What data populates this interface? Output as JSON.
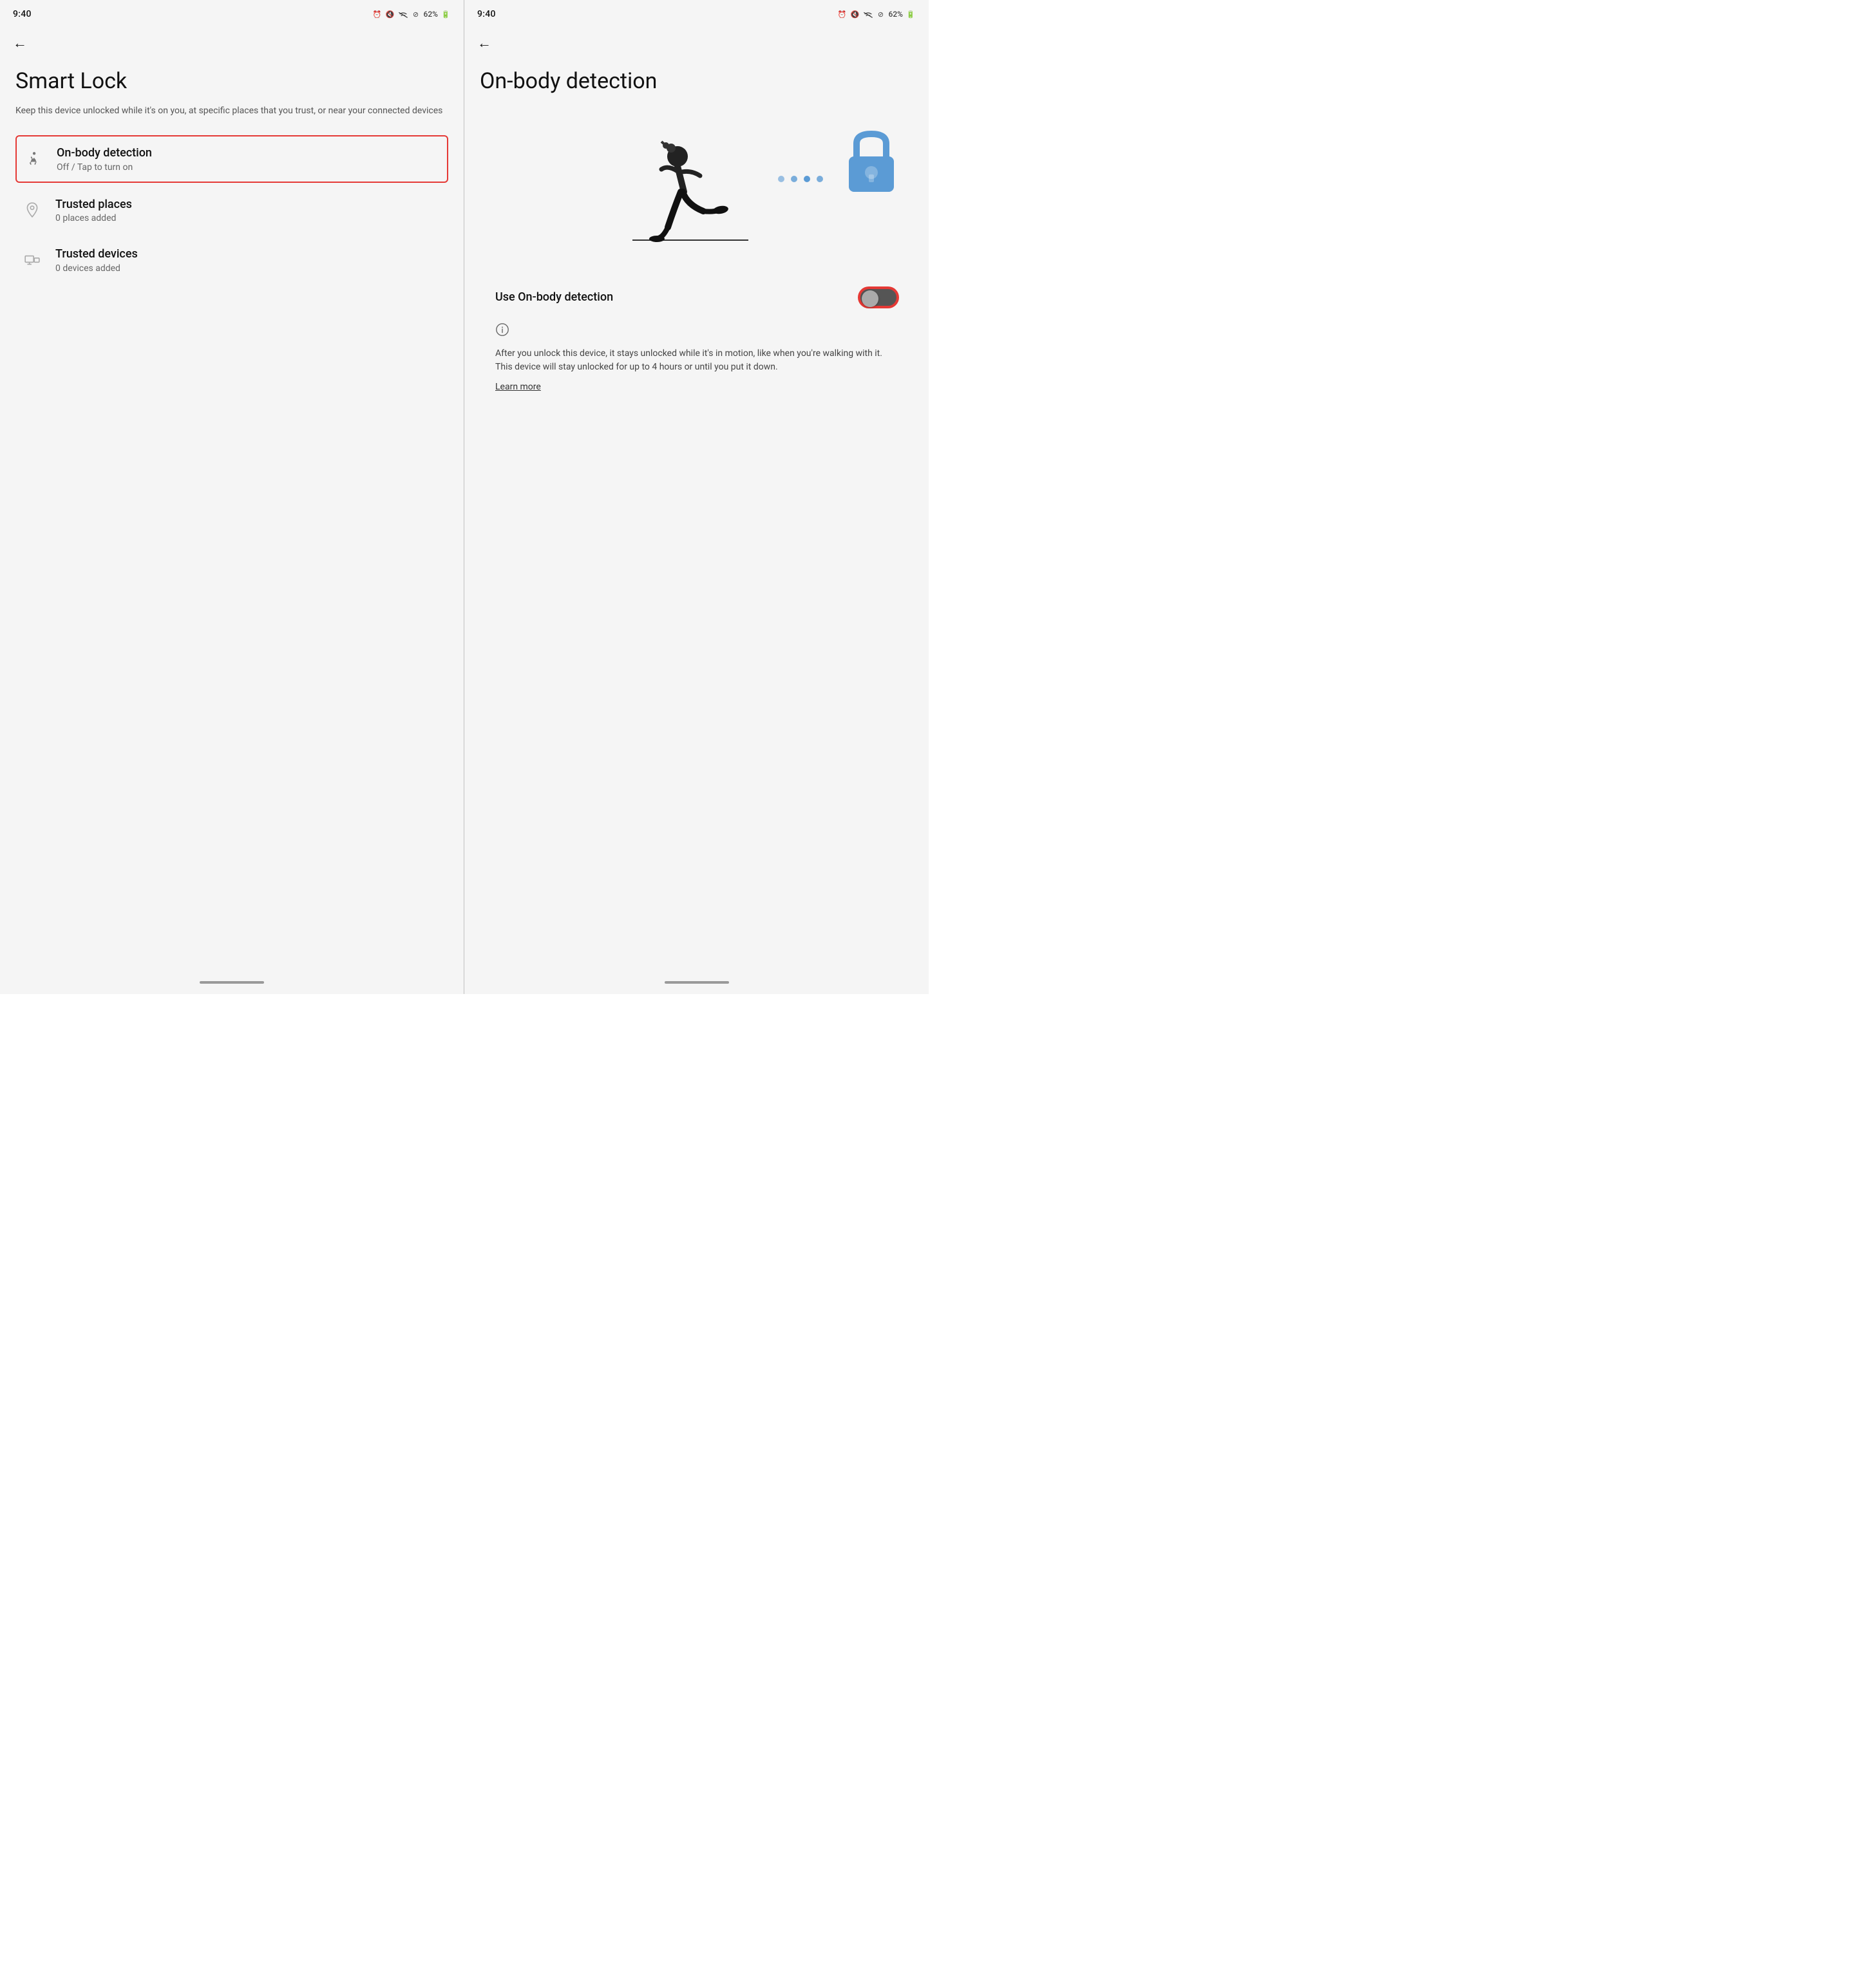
{
  "left_screen": {
    "status_bar": {
      "time": "9:40",
      "battery": "62%"
    },
    "back_button_label": "←",
    "title": "Smart Lock",
    "subtitle": "Keep this device unlocked while it's on you, at specific places that you trust, or near your connected devices",
    "menu_items": [
      {
        "id": "on-body-detection",
        "label": "On-body detection",
        "sublabel": "Off / Tap to turn on",
        "icon": "person-walking",
        "selected": true
      },
      {
        "id": "trusted-places",
        "label": "Trusted places",
        "sublabel": "0 places added",
        "icon": "location-pin",
        "selected": false
      },
      {
        "id": "trusted-devices",
        "label": "Trusted devices",
        "sublabel": "0 devices added",
        "icon": "devices",
        "selected": false
      }
    ]
  },
  "right_screen": {
    "status_bar": {
      "time": "9:40",
      "battery": "62%"
    },
    "back_button_label": "←",
    "title": "On-body detection",
    "toggle_label": "Use On-body detection",
    "toggle_state": false,
    "description": "After you unlock this device, it stays unlocked while it's in motion, like when you're walking with it. This device will stay unlocked for up to 4 hours or until you put it down.",
    "learn_more_label": "Learn more"
  }
}
